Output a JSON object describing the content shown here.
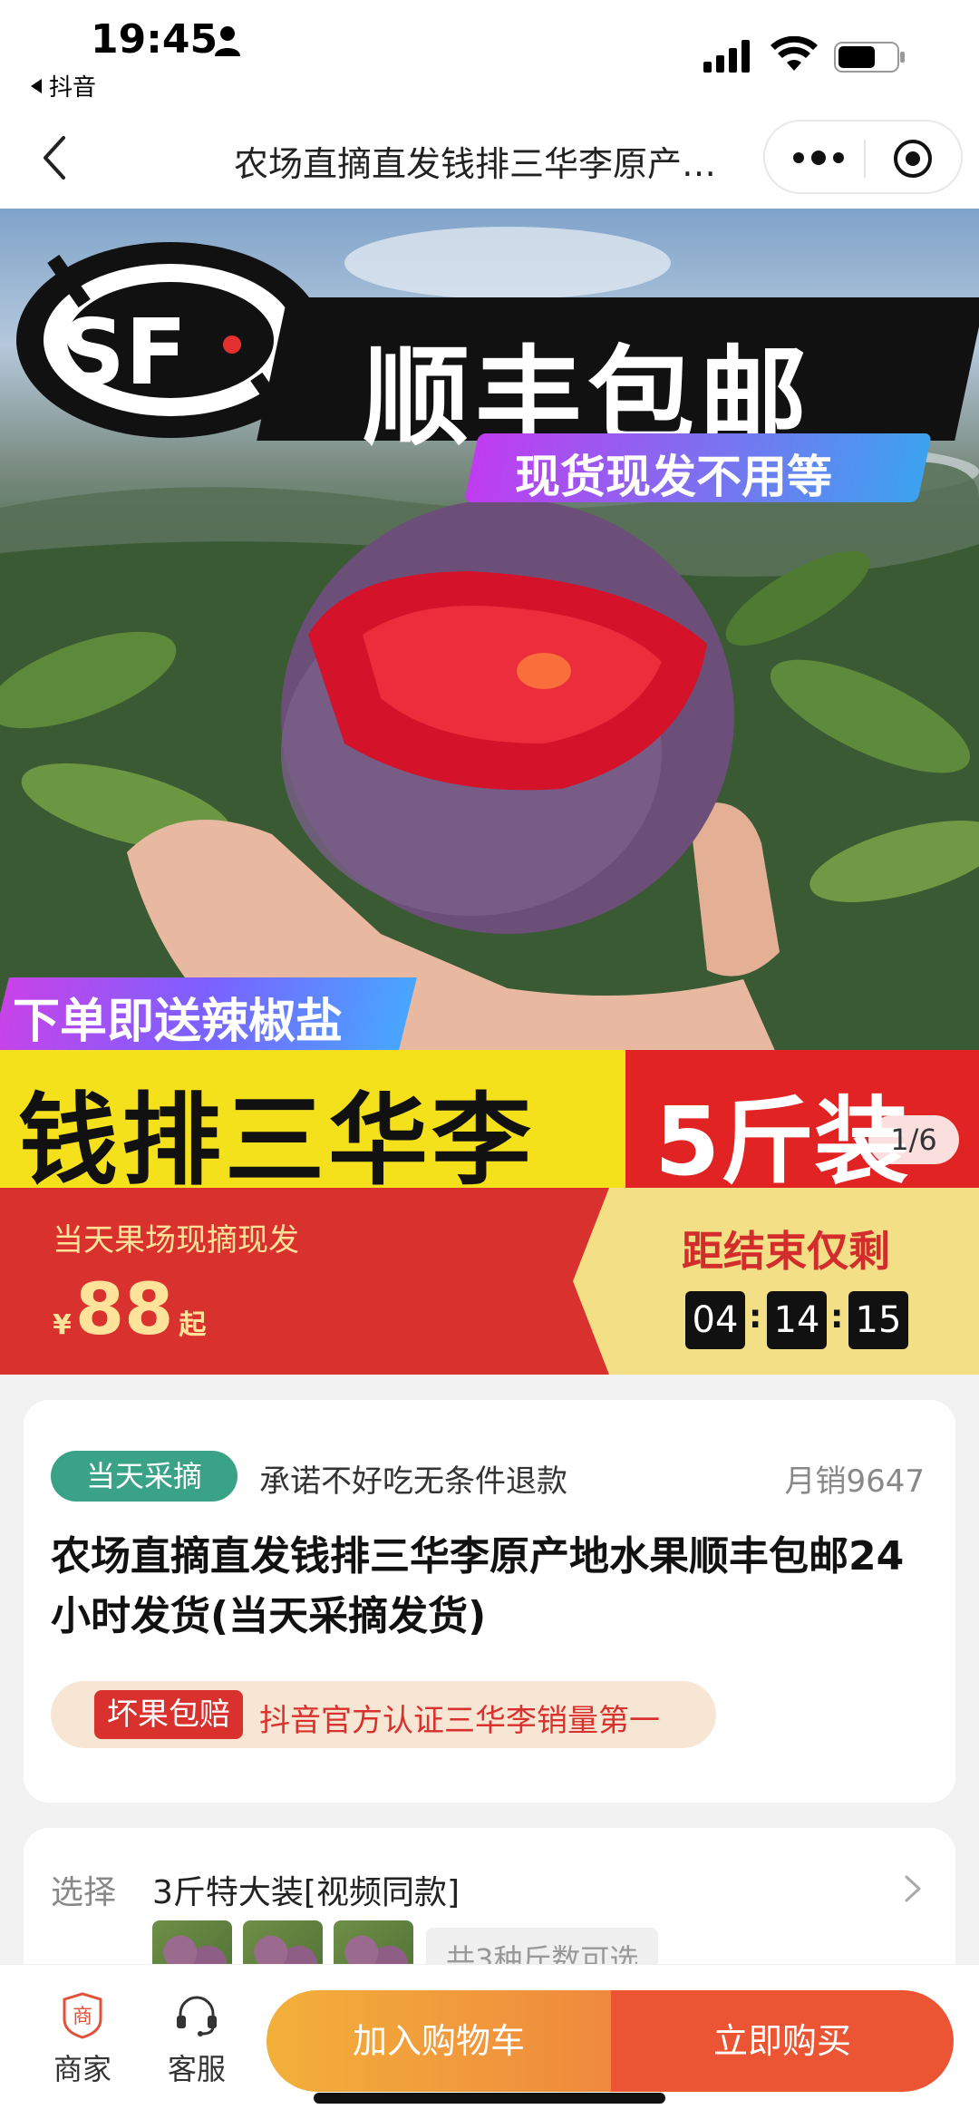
{
  "status_bar": {
    "time": "19:45",
    "back_app_label": "抖音"
  },
  "nav": {
    "title": "农场直摘直发钱排三华李原产…"
  },
  "hero": {
    "sf_logo_text": "SF",
    "sf_banner_text": "顺丰包邮",
    "sf_sub_text": "现货现发不用等",
    "gift_text": "下单即送辣椒盐",
    "band_left_text": "钱排三华李",
    "band_right_text": "5斤装",
    "counter": "1/6"
  },
  "price_banner": {
    "tag": "当天果场现摘现发",
    "currency": "¥",
    "value": "88",
    "suffix": "起",
    "countdown_label": "距结束仅剩",
    "hours": "04",
    "minutes": "14",
    "seconds": "15",
    "separator": ":"
  },
  "info": {
    "pick_badge": "当天采摘",
    "promise": "承诺不好吃无条件退款",
    "monthly_sales": "月销9647",
    "title": "农场直摘直发钱排三华李原产地水果顺丰包邮24小时发货(当天采摘发货)",
    "guarantee_tag": "坏果包赔",
    "guarantee_text": "抖音官方认证三华李销量第一"
  },
  "spec": {
    "label": "选择",
    "value": "3斤特大装[视频同款]",
    "count_text": "共3种斤数可选"
  },
  "action_bar": {
    "shop_label": "商家",
    "shop_icon_text": "商",
    "service_label": "客服",
    "cart_label": "加入购物车",
    "buy_label": "立即购买"
  },
  "colors": {
    "price_red": "#d9312e",
    "gold_text": "#ffe39a",
    "pick_green": "#3aa387",
    "cart_orange": "#f0893d",
    "buy_red": "#ec5533"
  },
  "icons": [
    "person-icon",
    "signal-icon",
    "wifi-icon",
    "battery-icon",
    "back-arrow-icon",
    "more-dots-icon",
    "close-target-icon",
    "chevron-right-icon",
    "shop-icon",
    "headset-icon"
  ]
}
